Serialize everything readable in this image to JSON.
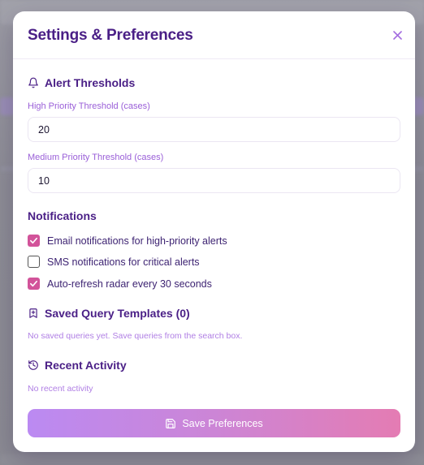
{
  "modal": {
    "title": "Settings & Preferences",
    "close_icon": "close-icon"
  },
  "alerts": {
    "heading": "Alert Thresholds",
    "icon": "bell-icon",
    "high": {
      "label": "High Priority Threshold (cases)",
      "value": "20"
    },
    "medium": {
      "label": "Medium Priority Threshold (cases)",
      "value": "10"
    }
  },
  "notifications": {
    "heading": "Notifications",
    "items": [
      {
        "label": "Email notifications for high-priority alerts",
        "checked": true
      },
      {
        "label": "SMS notifications for critical alerts",
        "checked": false
      },
      {
        "label": "Auto-refresh radar every 30 seconds",
        "checked": true
      }
    ]
  },
  "saved_queries": {
    "heading": "Saved Query Templates (0)",
    "icon": "bookmark-icon",
    "empty_text": "No saved queries yet. Save queries from the search box."
  },
  "recent_activity": {
    "heading": "Recent Activity",
    "icon": "history-icon",
    "empty_text": "No recent activity"
  },
  "save_button": {
    "label": "Save Preferences",
    "icon": "save-icon"
  },
  "colors": {
    "title": "#4a1f86",
    "label": "#9a5fd8",
    "checkbox_on": "#d2539a",
    "button_gradient_start": "#bb8af2",
    "button_gradient_end": "#e47cb3"
  }
}
